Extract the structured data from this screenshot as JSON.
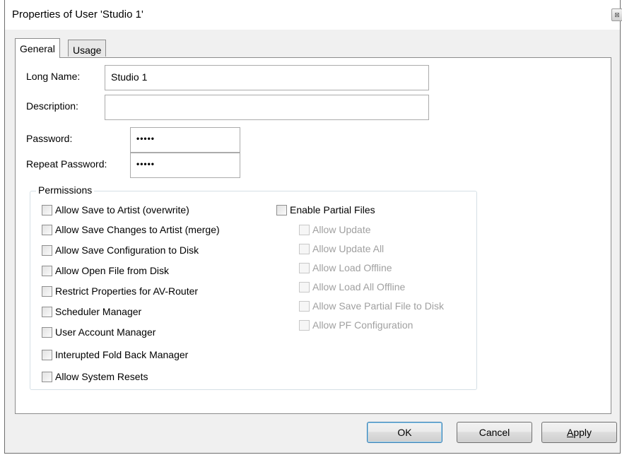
{
  "window": {
    "title": "Properties of User 'Studio 1'",
    "close_glyph": "⊠"
  },
  "tabs": [
    {
      "label": "General"
    },
    {
      "label": "Usage"
    }
  ],
  "form": {
    "long_name_label": "Long Name:",
    "long_name_value": "Studio 1",
    "description_label": "Description:",
    "description_value": "",
    "password_label": "Password:",
    "password_value": "•••••",
    "repeat_password_label": "Repeat Password:",
    "repeat_password_value": "•••••"
  },
  "permissions": {
    "legend": "Permissions",
    "left": [
      {
        "label": "Allow Save to Artist (overwrite)",
        "checked": false
      },
      {
        "label": "Allow Save Changes to Artist (merge)",
        "checked": false
      },
      {
        "label": "Allow Save Configuration to Disk",
        "checked": false
      },
      {
        "label": "Allow Open File from Disk",
        "checked": false
      },
      {
        "label": "Restrict Properties for AV-Router",
        "checked": false
      },
      {
        "label": "Scheduler Manager",
        "checked": false
      },
      {
        "label": "User Account Manager",
        "checked": false
      },
      {
        "label": "Interupted Fold Back  Manager",
        "checked": false
      },
      {
        "label": "Allow System Resets",
        "checked": false
      }
    ],
    "partial_files": {
      "label": "Enable Partial Files",
      "checked": false
    },
    "right": [
      {
        "label": "Allow Update",
        "checked": false,
        "enabled": false
      },
      {
        "label": "Allow Update All",
        "checked": false,
        "enabled": false
      },
      {
        "label": "Allow Load Offline",
        "checked": false,
        "enabled": false
      },
      {
        "label": "Allow Load All Offline",
        "checked": false,
        "enabled": false
      },
      {
        "label": "Allow Save Partial File to Disk",
        "checked": false,
        "enabled": false
      },
      {
        "label": "Allow PF Configuration",
        "checked": false,
        "enabled": false
      }
    ]
  },
  "buttons": {
    "ok": "OK",
    "cancel": "Cancel",
    "apply_prefix": "",
    "apply_mnemonic": "A",
    "apply_rest": "pply"
  }
}
